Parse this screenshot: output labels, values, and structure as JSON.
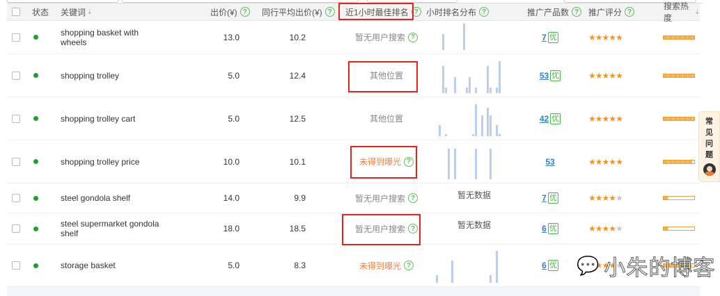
{
  "header": {
    "status": "状态",
    "keyword": "关键词",
    "bid": "出价(¥)",
    "avg_bid": "同行平均出价(¥)",
    "best_rank": "近1小时最佳排名",
    "distribution": "小时排名分布",
    "product_count": "推广产品数",
    "rating": "推广评分",
    "heat": "搜索热度",
    "help": "?",
    "sort": "⇣"
  },
  "badge_label": "优",
  "rows": [
    {
      "keyword": "shopping basket with wheels",
      "bid": "13.0",
      "avg": "10.2",
      "rank": "暂无用户搜索",
      "rank_type": "grey",
      "rank_help": true,
      "dist": [
        [
          2,
          0.6
        ],
        [
          9,
          1
        ]
      ],
      "count": "7",
      "you": true,
      "stars": 5,
      "heat": 1.0
    },
    {
      "keyword": "shopping trolley",
      "bid": "5.0",
      "avg": "12.4",
      "rank": "其他位置",
      "rank_type": "grey",
      "rank_help": false,
      "dist": [
        [
          2,
          0.85
        ],
        [
          3,
          0.18
        ],
        [
          6,
          0.5
        ],
        [
          10,
          0.18
        ],
        [
          11,
          0.5
        ],
        [
          13,
          0.18
        ],
        [
          17,
          0.85
        ],
        [
          18,
          0.18
        ],
        [
          20,
          0.18
        ],
        [
          21,
          1
        ]
      ],
      "count": "53",
      "you": true,
      "stars": 5,
      "heat": 1.0
    },
    {
      "keyword": "shopping trolley cart",
      "bid": "5.0",
      "avg": "12.5",
      "rank": "其他位置",
      "rank_type": "grey",
      "rank_help": false,
      "dist": [
        [
          1,
          0.35
        ],
        [
          3,
          0.07
        ],
        [
          12,
          0.07
        ],
        [
          13,
          1
        ],
        [
          15,
          0.65
        ],
        [
          17,
          0.9
        ],
        [
          18,
          0.65
        ],
        [
          20,
          0.35
        ],
        [
          21,
          0.07
        ]
      ],
      "count": "42",
      "you": true,
      "stars": 5,
      "heat": 1.0
    },
    {
      "keyword": "shopping trolley price",
      "bid": "10.0",
      "avg": "10.1",
      "rank": "未得到曝光",
      "rank_type": "orange",
      "rank_help": true,
      "dist": [
        [
          4,
          0.95
        ],
        [
          6,
          0.95
        ],
        [
          13,
          0.95
        ],
        [
          18,
          0.95
        ]
      ],
      "count": "53",
      "you": false,
      "stars": 5,
      "heat": 0.93
    },
    {
      "keyword": "steel gondola shelf",
      "bid": "14.0",
      "avg": "9.9",
      "rank": "暂无用户搜索",
      "rank_type": "grey",
      "rank_help": true,
      "no_data": "暂无数据",
      "count": "7",
      "you": true,
      "stars": 4,
      "heat": 0.15
    },
    {
      "keyword": "steel supermarket gondola shelf",
      "bid": "18.0",
      "avg": "18.5",
      "rank": "暂无用户搜索",
      "rank_type": "grey",
      "rank_help": true,
      "no_data": "暂无数据",
      "count": "6",
      "you": true,
      "stars": 4,
      "heat": 0.15
    },
    {
      "keyword": "storage basket",
      "bid": "5.0",
      "avg": "8.3",
      "rank": "未得到曝光",
      "rank_type": "orange",
      "rank_help": true,
      "dist": [
        [
          0,
          0.25
        ],
        [
          5,
          0.7
        ],
        [
          18,
          0.25
        ],
        [
          20,
          1
        ]
      ],
      "count": "6",
      "you": true,
      "stars": 4,
      "heat": 0.9
    }
  ],
  "faq": [
    "常",
    "见",
    "问",
    "题"
  ],
  "watermark": "小朱的博客",
  "colors": {
    "accent_red": "#e8201e",
    "orange": "#f5803e",
    "green": "#1fa02f",
    "link": "#2d7fd0"
  }
}
